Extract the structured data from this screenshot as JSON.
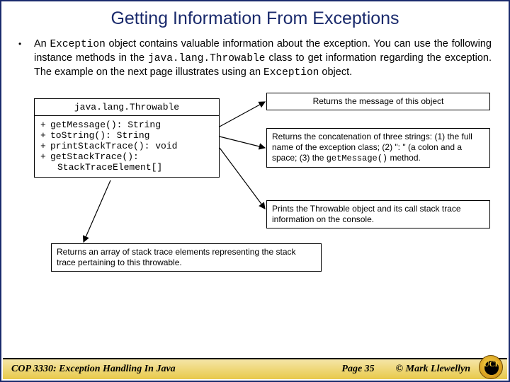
{
  "title": "Getting Information From Exceptions",
  "bullet": {
    "p1a": "An ",
    "p1b": "Exception",
    "p1c": " object contains valuable information about the exception.  You can use the following instance methods in the ",
    "p1d": "java.lang.Throwable",
    "p1e": " class to get information regarding the exception.  The example on the next page illustrates using an ",
    "p1f": "Exception",
    "p1g": " object."
  },
  "uml": {
    "head": "java.lang.Throwable",
    "rows": [
      "getMessage(): String",
      "toString(): String",
      "printStackTrace(): void",
      "getStackTrace():"
    ],
    "last": "StackTraceElement[]"
  },
  "desc": {
    "d1": "Returns the message of this object",
    "d2a": "Returns the concatenation of three strings: (1) the full name of the exception class; (2) \": \" (a colon and a space; (3) the ",
    "d2b": "getMessage()",
    "d2c": " method.",
    "d3": "Prints the Throwable object and its call stack trace information on the console.",
    "d4": "Returns an array of stack trace elements representing the stack trace pertaining to this throwable."
  },
  "footer": {
    "left": "COP 3330:  Exception Handling In Java",
    "mid": "Page 35",
    "right": "© Mark Llewellyn"
  },
  "logo": "UCF"
}
